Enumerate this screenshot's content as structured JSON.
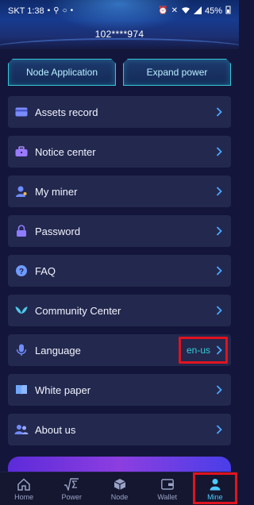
{
  "status_bar": {
    "time": "SKT 1:38",
    "battery": "45%"
  },
  "header": {
    "account_id": "102****974"
  },
  "top_buttons": {
    "node_application": "Node Application",
    "expand_power": "Expand power"
  },
  "menu": {
    "items": [
      {
        "label": "Assets record",
        "icon": "wallet-card-icon"
      },
      {
        "label": "Notice center",
        "icon": "briefcase-icon"
      },
      {
        "label": "My miner",
        "icon": "user-key-icon"
      },
      {
        "label": "Password",
        "icon": "lock-icon"
      },
      {
        "label": "FAQ",
        "icon": "question-icon"
      },
      {
        "label": "Community Center",
        "icon": "wings-icon"
      },
      {
        "label": "Language",
        "icon": "microphone-icon",
        "value": "en-us"
      },
      {
        "label": "White paper",
        "icon": "book-icon"
      },
      {
        "label": "About us",
        "icon": "users-icon"
      }
    ]
  },
  "tab_bar": {
    "tabs": [
      {
        "label": "Home",
        "icon": "home-icon"
      },
      {
        "label": "Power",
        "icon": "sqrt-sigma-icon"
      },
      {
        "label": "Node",
        "icon": "cube-icon"
      },
      {
        "label": "Wallet",
        "icon": "wallet-icon"
      },
      {
        "label": "Mine",
        "icon": "person-icon",
        "active": true
      }
    ]
  },
  "colors": {
    "background": "#13163a",
    "card": "#23284e",
    "accent": "#35d0d8",
    "highlight": "#e0131f",
    "active_tab": "#4ec9ff"
  }
}
